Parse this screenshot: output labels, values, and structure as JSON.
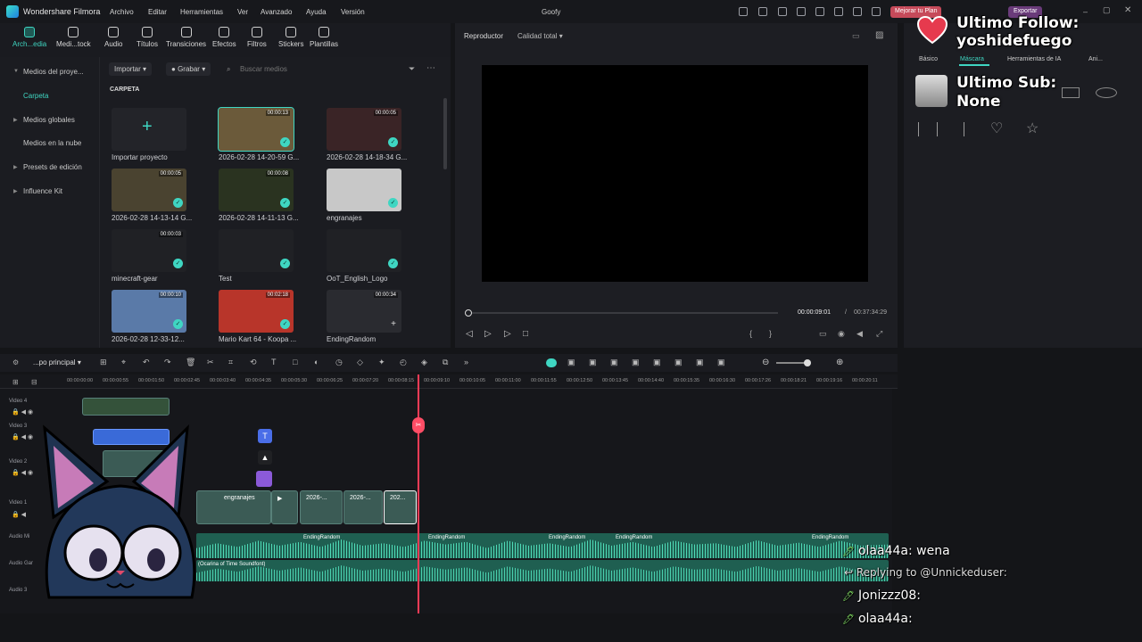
{
  "app": {
    "name": "Wondershare Filmora",
    "project": "Goofy",
    "upgrade": "Mejorar tu Plan",
    "export": "Exportar"
  },
  "menu": [
    "Archivo",
    "Editar",
    "Herramientas",
    "Ver",
    "Avanzado",
    "Ayuda",
    "Versión"
  ],
  "toolbar": [
    {
      "label": "Arch...edia",
      "icon": "media-icon"
    },
    {
      "label": "Medi...tock",
      "icon": "stock-icon"
    },
    {
      "label": "Audio",
      "icon": "music-note-icon"
    },
    {
      "label": "Títulos",
      "icon": "title-t-icon"
    },
    {
      "label": "Transiciones",
      "icon": "transition-icon"
    },
    {
      "label": "Efectos",
      "icon": "effects-sparkle-icon"
    },
    {
      "label": "Filtros",
      "icon": "filter-icon"
    },
    {
      "label": "Stickers",
      "icon": "sticker-icon"
    },
    {
      "label": "Plantillas",
      "icon": "template-icon"
    }
  ],
  "sidebar": {
    "items": [
      {
        "label": "Medios del proye...",
        "expand": true
      },
      {
        "label": "Carpeta",
        "active": true
      },
      {
        "label": "Medios globales",
        "expand": true
      },
      {
        "label": "Medios en la nube"
      },
      {
        "label": "Presets de edición",
        "expand": true
      },
      {
        "label": "Influence Kit",
        "expand": true
      }
    ]
  },
  "media": {
    "import": "Importar",
    "record": "Grabar",
    "search_placeholder": "Buscar medios",
    "folder_label": "CARPETA",
    "import_project": "Importar proyecto",
    "items": [
      {
        "label": "2026-02-28 14-20-59 G...",
        "duration": "00:00:13",
        "selected": true,
        "color": "#6b5a3a"
      },
      {
        "label": "2026-02-28 14-18-34 G...",
        "duration": "00:00:05",
        "color": "#3a2426"
      },
      {
        "label": "2026-02-28 14-13-14 G...",
        "duration": "00:00:05",
        "color": "#4a4330"
      },
      {
        "label": "2026-02-28 14-11-13 G...",
        "duration": "00:00:08",
        "color": "#2a3320"
      },
      {
        "label": "engranajes",
        "duration": "",
        "color": "#c8c8c8"
      },
      {
        "label": "minecraft-gear",
        "duration": "00:00:03",
        "color": "#202125"
      },
      {
        "label": "Test",
        "duration": "",
        "color": "#202125"
      },
      {
        "label": "OoT_English_Logo",
        "duration": "",
        "color": "#202125"
      },
      {
        "label": "2026-02-28 12-33-12...",
        "duration": "00:00:10",
        "color": "#5a7aa8"
      },
      {
        "label": "Mario Kart 64 - Koopa ...",
        "duration": "00:02:18",
        "color": "#b8352a"
      },
      {
        "label": "EndingRandom",
        "duration": "00:00:34",
        "color": "#2a2b30"
      }
    ]
  },
  "player": {
    "label": "Reproductor",
    "quality": "Calidad total",
    "current": "00:00:09:01",
    "total": "00:37:34:29"
  },
  "rpanel": {
    "tabs": [
      "Básico",
      "Máscara",
      "Herramientas de IA",
      "Ani..."
    ]
  },
  "timeline": {
    "sequence": "...po principal",
    "ruler": [
      "00:00:00:00",
      "00:00:00:55",
      "00:00:01:50",
      "00:00:02:45",
      "00:00:03:40",
      "00:00:04:35",
      "00:00:05:30",
      "00:00:06:25",
      "00:00:07:20",
      "00:00:08:15",
      "00:00:09:10",
      "00:00:10:05",
      "00:00:11:00",
      "00:00:11:55",
      "00:00:12:50",
      "00:00:13:45",
      "00:00:14:40",
      "00:00:15:35",
      "00:00:16:30",
      "00:00:17:26",
      "00:00:18:21",
      "00:00:19:16",
      "00:00:20:11"
    ],
    "tracks": [
      "Video 4",
      "Video 3",
      "Video 2",
      "Video 1",
      "Audio Mi",
      "Audio Gar",
      "Audio 3"
    ],
    "clips": {
      "engranajes": "engranajes",
      "c2": "2026-...",
      "c3": "2026-...",
      "c4": "202...",
      "ending": "EndingRandom",
      "audio": "(Ocarina of Time Soundfont)"
    }
  },
  "overlay": {
    "follow_label": "Ultimo Follow:",
    "follow_user": "yoshidefuego",
    "sub_label": "Ultimo Sub:",
    "sub_user": "None"
  },
  "chat": [
    {
      "user": "olaa44a:",
      "text": "wena"
    },
    {
      "reply": "Replying to @Unnickeduser:"
    },
    {
      "user": "Jonizzz08:",
      "text": ""
    },
    {
      "user": "olaa44a:",
      "text": ""
    }
  ]
}
